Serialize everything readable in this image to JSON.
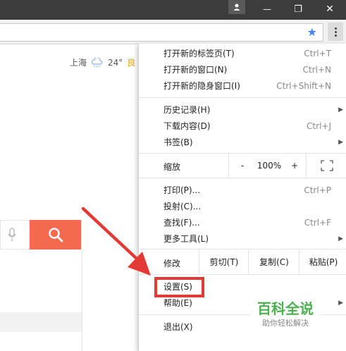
{
  "window": {
    "minimize_glyph": "—",
    "maximize_glyph": "❐",
    "close_glyph": "✕"
  },
  "weather": {
    "city": "上海",
    "temp": "24°",
    "aqi": "良"
  },
  "menu": {
    "items": [
      {
        "label": "打开新的标签页(T)",
        "shortcut": "Ctrl+T"
      },
      {
        "label": "打开新的窗口(N)",
        "shortcut": "Ctrl+N"
      },
      {
        "label": "打开新的隐身窗口(I)",
        "shortcut": "Ctrl+Shift+N"
      },
      {
        "label": "历史记录(H)",
        "submenu": "▶"
      },
      {
        "label": "下载内容(D)",
        "shortcut": "Ctrl+J"
      },
      {
        "label": "书签(B)",
        "submenu": "▶"
      },
      {
        "label": "打印(P)...",
        "shortcut": "Ctrl+P"
      },
      {
        "label": "投射(C)..."
      },
      {
        "label": "查找(F)...",
        "shortcut": "Ctrl+F"
      },
      {
        "label": "更多工具(L)",
        "submenu": "▶"
      },
      {
        "label": "设置(S)"
      },
      {
        "label": "帮助(E)",
        "submenu": "▶"
      },
      {
        "label": "退出(X)"
      }
    ],
    "zoom": {
      "label": "缩放",
      "minus": "-",
      "value": "100%",
      "plus": "+"
    },
    "edit": {
      "label": "修改",
      "cut": "剪切(T)",
      "copy": "复制(C)",
      "paste": "粘贴(P)"
    }
  },
  "watermark": {
    "title": "百科全说",
    "subtitle": "助你轻松解决"
  },
  "colors": {
    "accent": "#f46a4f",
    "highlight": "#e33a35",
    "star": "#4285f4"
  }
}
